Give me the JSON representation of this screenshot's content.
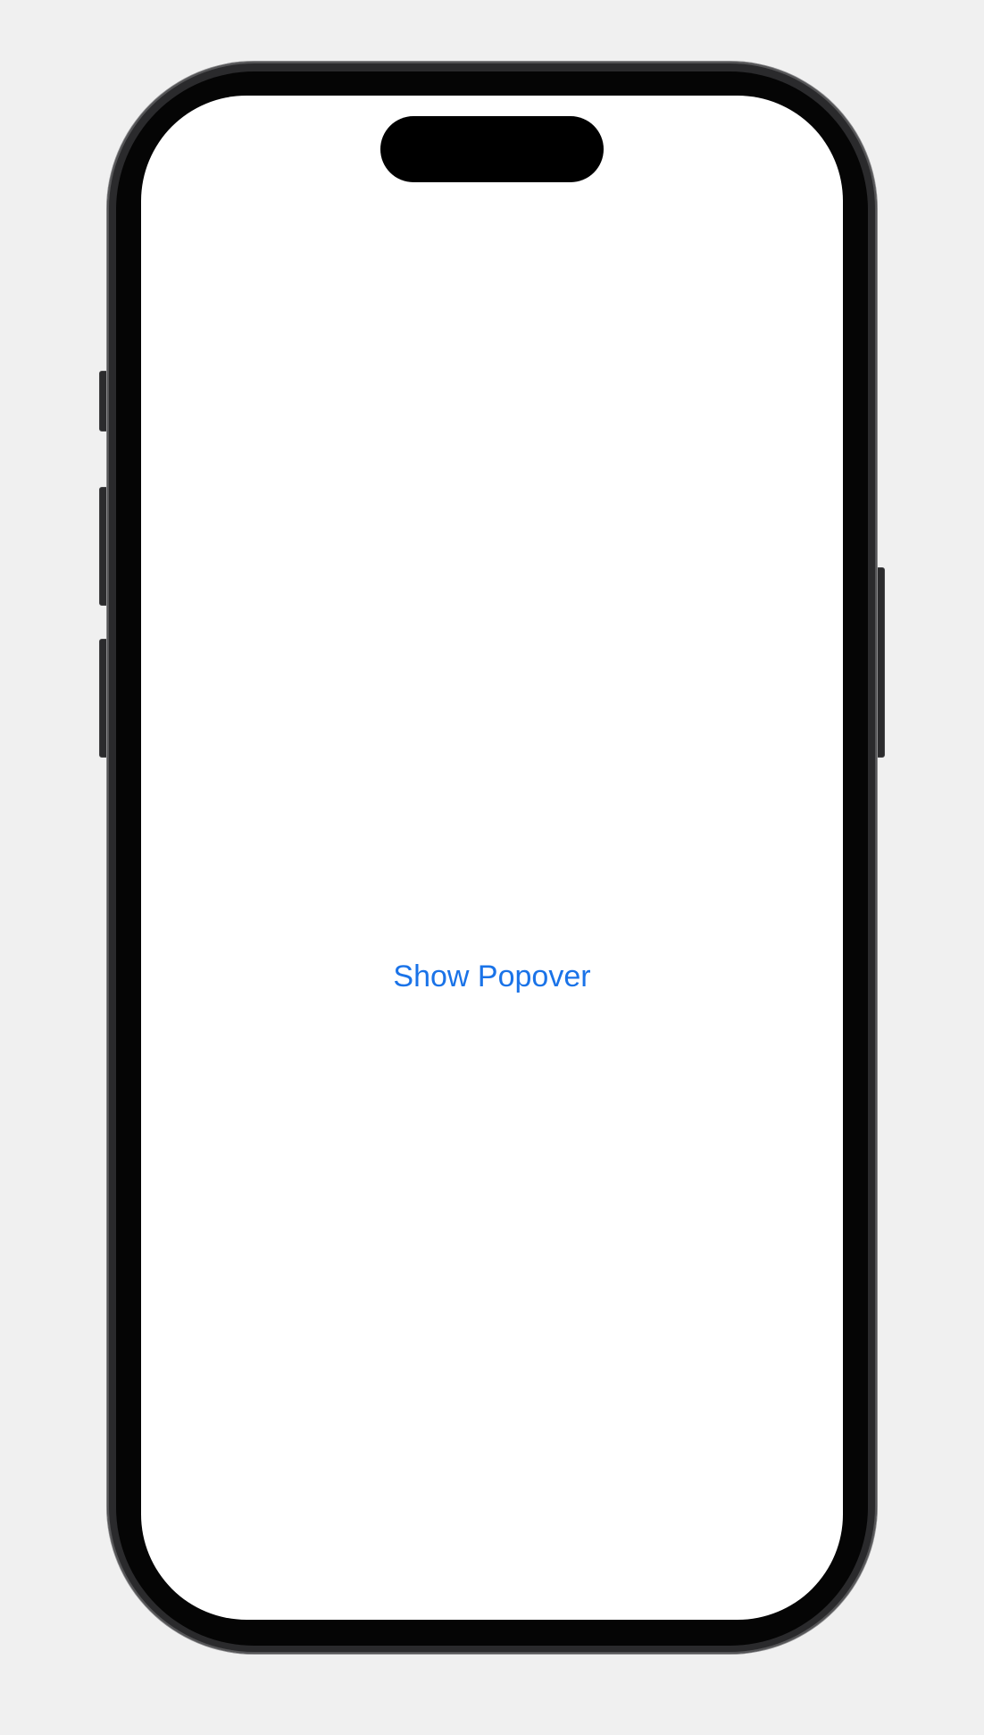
{
  "device": {
    "frame_color": "#2a2a2c",
    "bezel_color": "#050505",
    "screen_color": "#ffffff",
    "island_color": "#000000",
    "page_background": "#f0f0f0"
  },
  "screen": {
    "show_popover_button": {
      "label": "Show Popover",
      "color": "#1a73e8"
    }
  }
}
